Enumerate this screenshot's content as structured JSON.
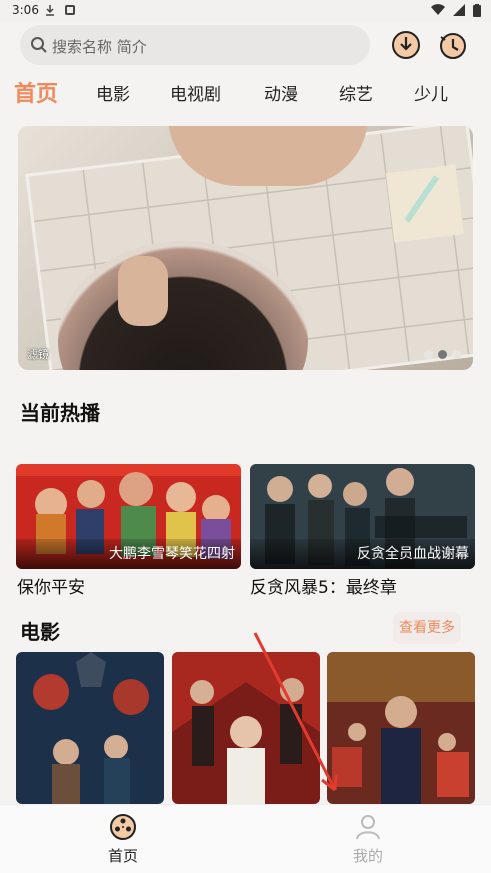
{
  "status_bar": {
    "time": "3:06"
  },
  "search": {
    "placeholder": "搜索名称 简介"
  },
  "tabs": [
    {
      "label": "首页",
      "active": true
    },
    {
      "label": "电影"
    },
    {
      "label": "电视剧"
    },
    {
      "label": "动漫"
    },
    {
      "label": "综艺"
    },
    {
      "label": "少儿"
    }
  ],
  "banner": {
    "caption": "滤镜",
    "slide_count": 3,
    "active_slide": 2
  },
  "hot_section": {
    "title": "当前热播",
    "items": [
      {
        "title": "保你平安",
        "subtitle": "大鹏李雪琴笑花四射"
      },
      {
        "title": "反贪风暴5：最终章",
        "subtitle": "反贪全员血战谢幕"
      }
    ]
  },
  "movie_section": {
    "title": "电影",
    "more_label": "查看更多"
  },
  "bottom_nav": [
    {
      "label": "首页",
      "active": true
    },
    {
      "label": "我的"
    }
  ],
  "colors": {
    "accent": "#f08a5d",
    "annotation": "#e23b2e"
  }
}
